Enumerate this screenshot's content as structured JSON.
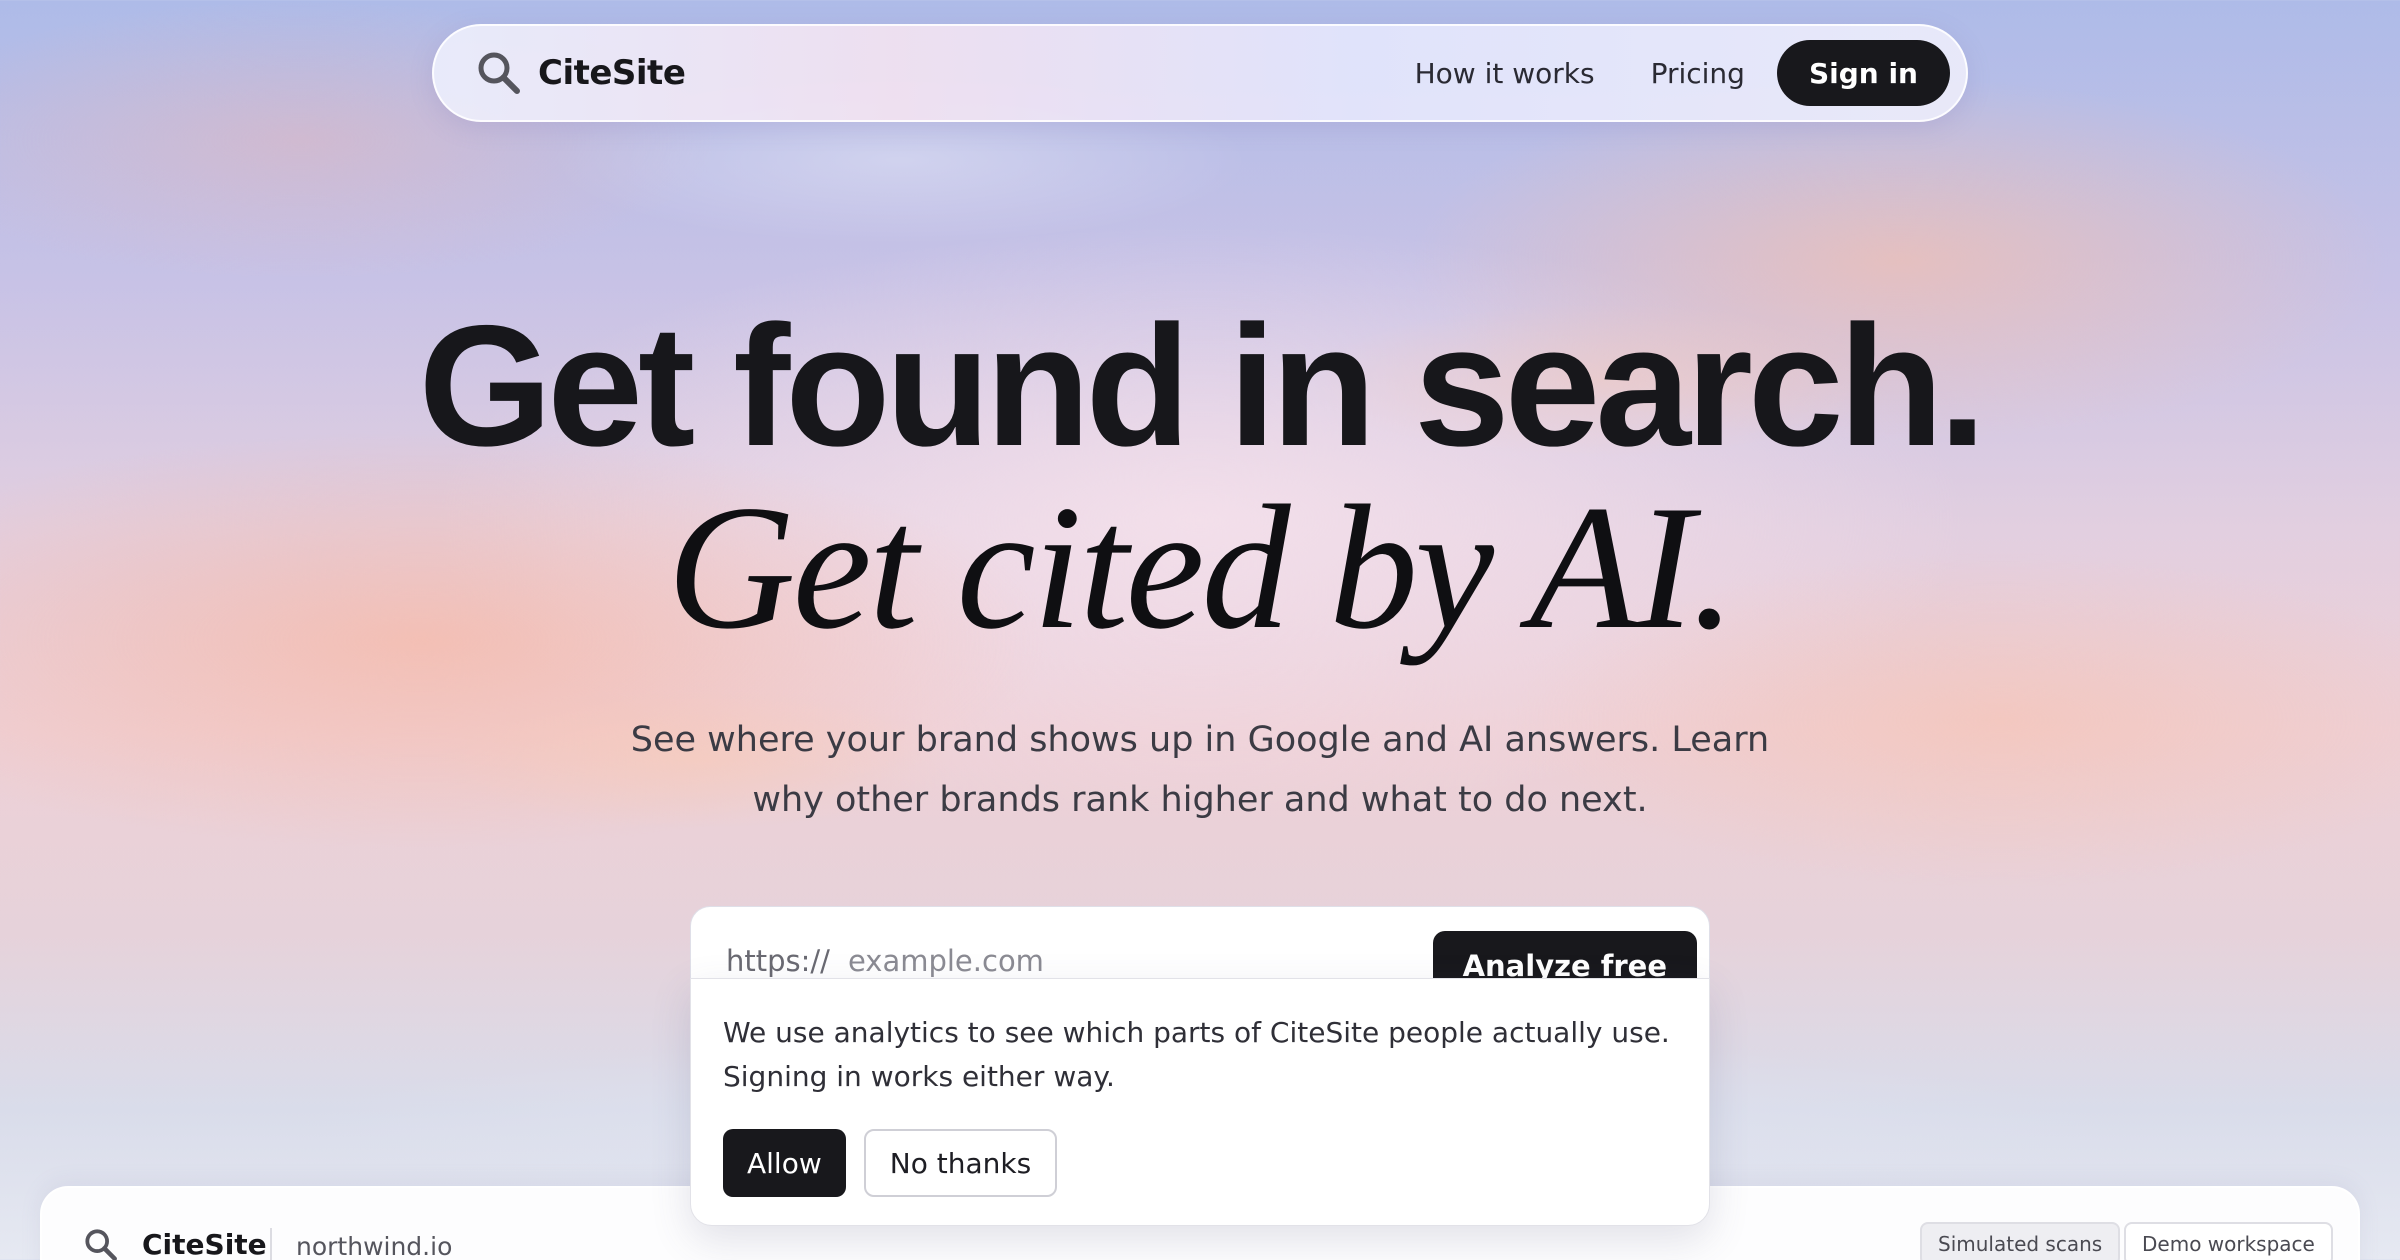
{
  "nav": {
    "brand_name": "CiteSite",
    "brand_icon": "search-icon",
    "links": [
      "How it works",
      "Pricing"
    ],
    "signin_label": "Sign in"
  },
  "hero": {
    "title_line1": "Get found in search.",
    "title_line2": "Get cited by AI.",
    "subtitle": "See where your brand shows up in Google and AI answers. Learn why other brands rank higher and what to do next."
  },
  "url_form": {
    "prefix": "https://",
    "placeholder": "example.com",
    "submit_label": "Analyze free"
  },
  "consent": {
    "text_line1": "We use analytics to see which parts of CiteSite people actually use.",
    "text_line2": "Signing in works either way.",
    "allow_label": "Allow",
    "decline_label": "No thanks"
  },
  "preview": {
    "brand_name": "CiteSite",
    "domain": "northwind.io",
    "badges": [
      "Simulated scans",
      "Demo workspace"
    ]
  },
  "colors": {
    "primary_dark": "#18181c",
    "text": "#17171b",
    "muted": "#3b3b44"
  }
}
